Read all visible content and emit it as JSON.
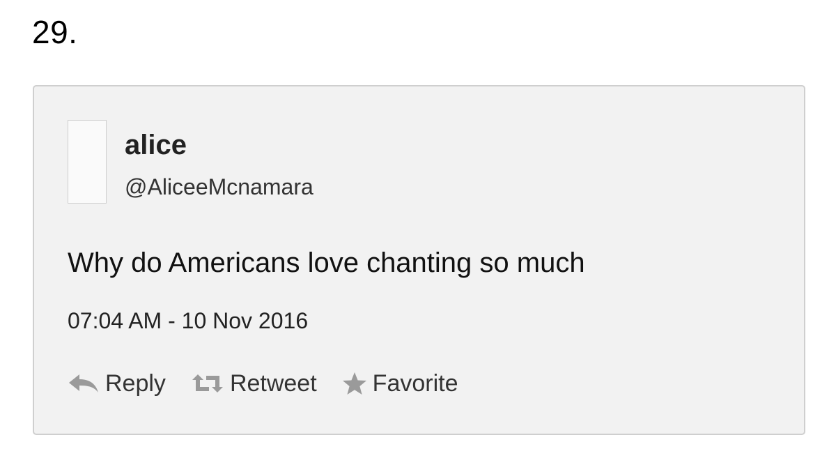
{
  "item_number": "29.",
  "tweet": {
    "display_name": "alice",
    "handle": "@AliceeMcnamara",
    "text": "Why do Americans love chanting so much",
    "timestamp": "07:04 AM - 10 Nov 2016"
  },
  "actions": {
    "reply": {
      "label": "Reply",
      "icon": "reply-icon"
    },
    "retweet": {
      "label": "Retweet",
      "icon": "retweet-icon"
    },
    "favorite": {
      "label": "Favorite",
      "icon": "star-icon"
    }
  },
  "colors": {
    "card_background": "#f2f2f2",
    "card_border": "#cfcfcf",
    "icon_gray": "#9a9a9a"
  }
}
